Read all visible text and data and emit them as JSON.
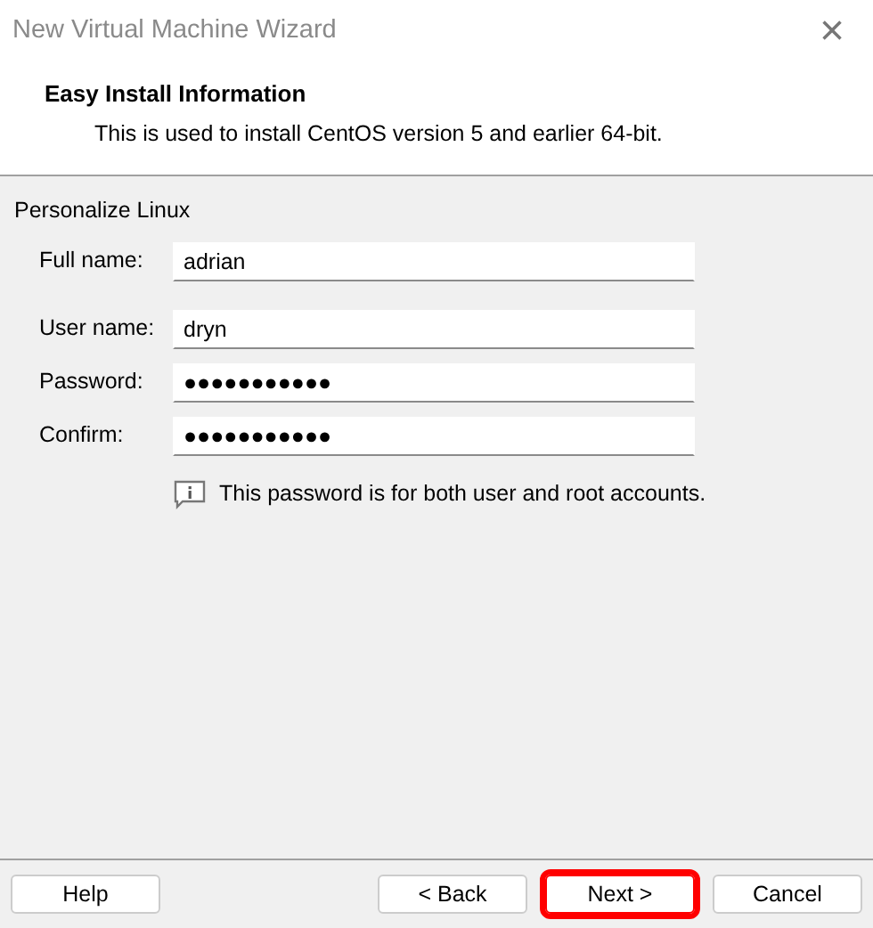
{
  "window": {
    "title": "New Virtual Machine Wizard",
    "close": "×"
  },
  "header": {
    "title": "Easy Install Information",
    "subtitle": "This is used to install CentOS version 5 and earlier 64-bit."
  },
  "section": "Personalize Linux",
  "field_groups": [
    [
      {
        "label": "Full name:",
        "value": "adrian"
      }
    ],
    [
      {
        "label": "User name:",
        "value": "dryn"
      },
      {
        "label": "Password:",
        "value": "●●●●●●●●●●●"
      },
      {
        "label": "Confirm:",
        "value": "●●●●●●●●●●●"
      }
    ]
  ],
  "note": "This password is for both user and root accounts.",
  "buttons": [
    {
      "label": "Help",
      "highlighted": false
    },
    {
      "label": "< Back",
      "highlighted": false
    },
    {
      "label": "Next >",
      "highlighted": true
    },
    {
      "label": "Cancel",
      "highlighted": false
    }
  ]
}
